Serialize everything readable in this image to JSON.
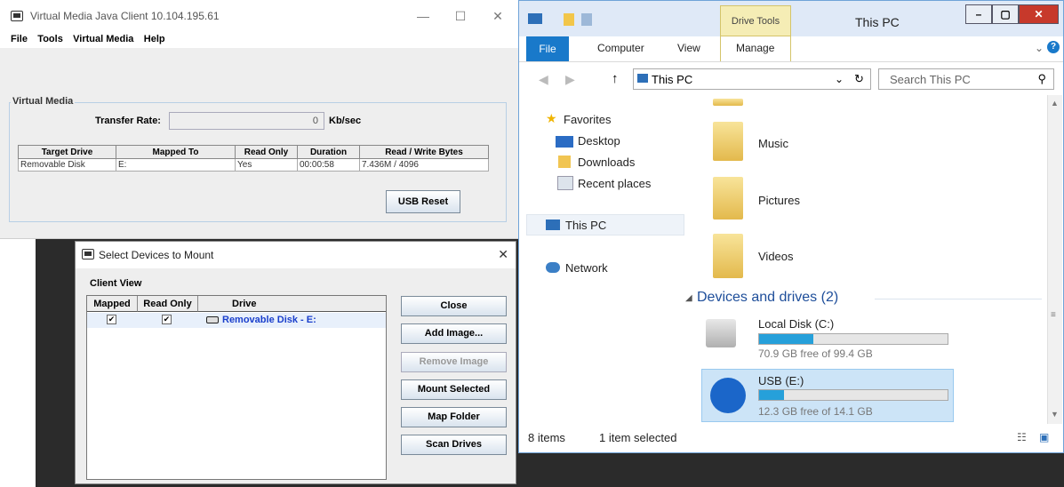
{
  "java_client": {
    "title": "Virtual Media Java Client 10.104.195.61",
    "menu": [
      "File",
      "Tools",
      "Virtual Media",
      "Help"
    ],
    "section_title": "Virtual Media",
    "transfer_rate_label": "Transfer Rate:",
    "transfer_rate_value": "0",
    "transfer_rate_unit": "Kb/sec",
    "table": {
      "headers": [
        "Target Drive",
        "Mapped To",
        "Read Only",
        "Duration",
        "Read / Write Bytes"
      ],
      "rows": [
        [
          "Removable Disk",
          "E:",
          "Yes",
          "00:00:58",
          "7.436M / 4096"
        ]
      ]
    },
    "usb_reset_label": "USB Reset"
  },
  "select_devices": {
    "title": "Select Devices to Mount",
    "close_x": "✕",
    "client_view_label": "Client View",
    "headers": [
      "Mapped",
      "Read Only",
      "Drive"
    ],
    "rows": [
      {
        "mapped": "✔",
        "read_only": "✔",
        "drive": "Removable Disk - E:"
      }
    ],
    "buttons": [
      "Close",
      "Add Image...",
      "Remove Image",
      "Mount Selected",
      "Map Folder",
      "Scan Drives"
    ]
  },
  "explorer": {
    "title": "This PC",
    "drive_tools": "Drive Tools",
    "ribbon_tabs": [
      "File",
      "Computer",
      "View",
      "Manage"
    ],
    "address": "This PC",
    "search_placeholder": "Search This PC",
    "nav": {
      "favorites": "Favorites",
      "desktop": "Desktop",
      "downloads": "Downloads",
      "recent": "Recent places",
      "this_pc": "This PC",
      "network": "Network"
    },
    "folders": [
      "Music",
      "Pictures",
      "Videos"
    ],
    "devices_header": "Devices and drives (2)",
    "drives": [
      {
        "name": "Local Disk (C:)",
        "free": "70.9 GB free of 99.4 GB",
        "used_fraction": 0.29
      },
      {
        "name": "USB (E:)",
        "free": "12.3 GB free of 14.1 GB",
        "used_fraction": 0.13
      }
    ],
    "status_items": "8 items",
    "status_selected": "1 item selected"
  }
}
